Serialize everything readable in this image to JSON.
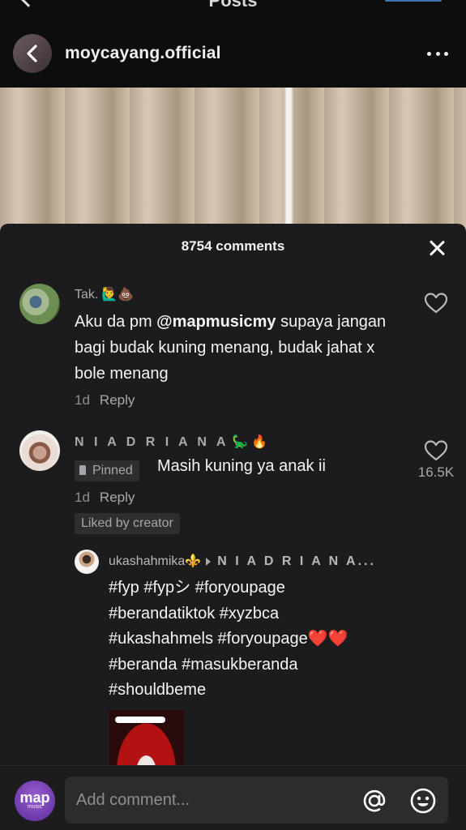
{
  "topbar": {
    "title": "Posts",
    "account_name": "moycayang.official"
  },
  "sheet": {
    "header": "8754 comments"
  },
  "comments": [
    {
      "username": "Tak.",
      "emoji": "🙋‍♂️💩",
      "text_prefix": "Aku da pm ",
      "mention": "@mapmusicmy",
      "text_suffix": " supaya jangan bagi budak kuning menang, budak jahat x bole menang",
      "time": "1d",
      "reply": "Reply"
    },
    {
      "username": "N I A D R I A N A",
      "emoji": "🦕🔥",
      "pinned_label": "Pinned",
      "text": "Masih kuning ya anak ii",
      "time": "1d",
      "reply": "Reply",
      "liked_label": "Liked by creator",
      "like_count": "16.5K"
    }
  ],
  "reply": {
    "username": "ukashahmika",
    "emoji": "⚜️",
    "target": "N I A D R I A N A...",
    "lines": [
      "#fyp #fypシ #foryoupage",
      "#berandatiktok #xyzbca",
      "#ukashahmels #foryoupage❤️❤️",
      "#beranda #masukberanda",
      "#shouldbeme"
    ]
  },
  "composer": {
    "avatar_logo": "map",
    "avatar_sub": "music",
    "placeholder": "Add comment..."
  },
  "colors": {
    "sheet_bg": "#1c1c1e",
    "text_primary": "#f4f4f4",
    "text_secondary": "#8e8e93"
  }
}
